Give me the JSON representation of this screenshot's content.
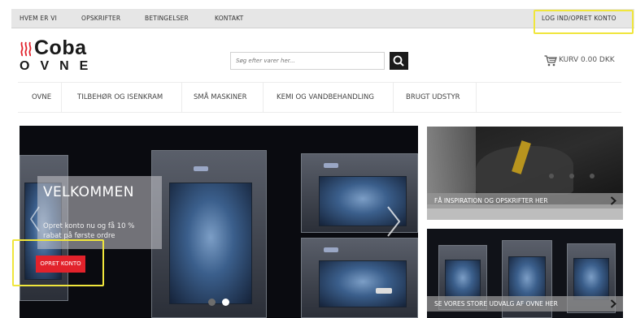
{
  "topbar": {
    "links": [
      "HVEM ER VI",
      "OPSKRIFTER",
      "BETINGELSER",
      "KONTAKT"
    ],
    "login": "LOG IND/OPRET KONTO"
  },
  "logo": {
    "word": "Coba",
    "sub": "OVNE"
  },
  "search": {
    "placeholder": "Søg efter varer her..."
  },
  "cart": {
    "label": "KURV 0.00 DKK"
  },
  "nav": {
    "items": [
      "OVNE",
      "TILBEHØR OG ISENKRAM",
      "SMÅ MASKINER",
      "KEMI OG VANDBEHANDLING",
      "BRUGT UDSTYR"
    ]
  },
  "hero": {
    "title": "VELKOMMEN",
    "text": "Opret konto nu og få 10 % rabat på første ordre",
    "button": "OPRET KONTO",
    "slides_total": 2,
    "slide_active": 2
  },
  "panels": [
    {
      "caption": "FÅ INSPIRATION OG OPSKRIFTER HER"
    },
    {
      "caption": "SE VORES STORE UDVALG AF OVNE HER"
    }
  ],
  "colors": {
    "accent_red": "#e2222b",
    "highlight_yellow": "#f0e63c",
    "dark": "#1b1b1b"
  },
  "icons": [
    "flame-icon",
    "search-icon",
    "cart-icon",
    "chevron-left-icon",
    "chevron-right-icon"
  ]
}
